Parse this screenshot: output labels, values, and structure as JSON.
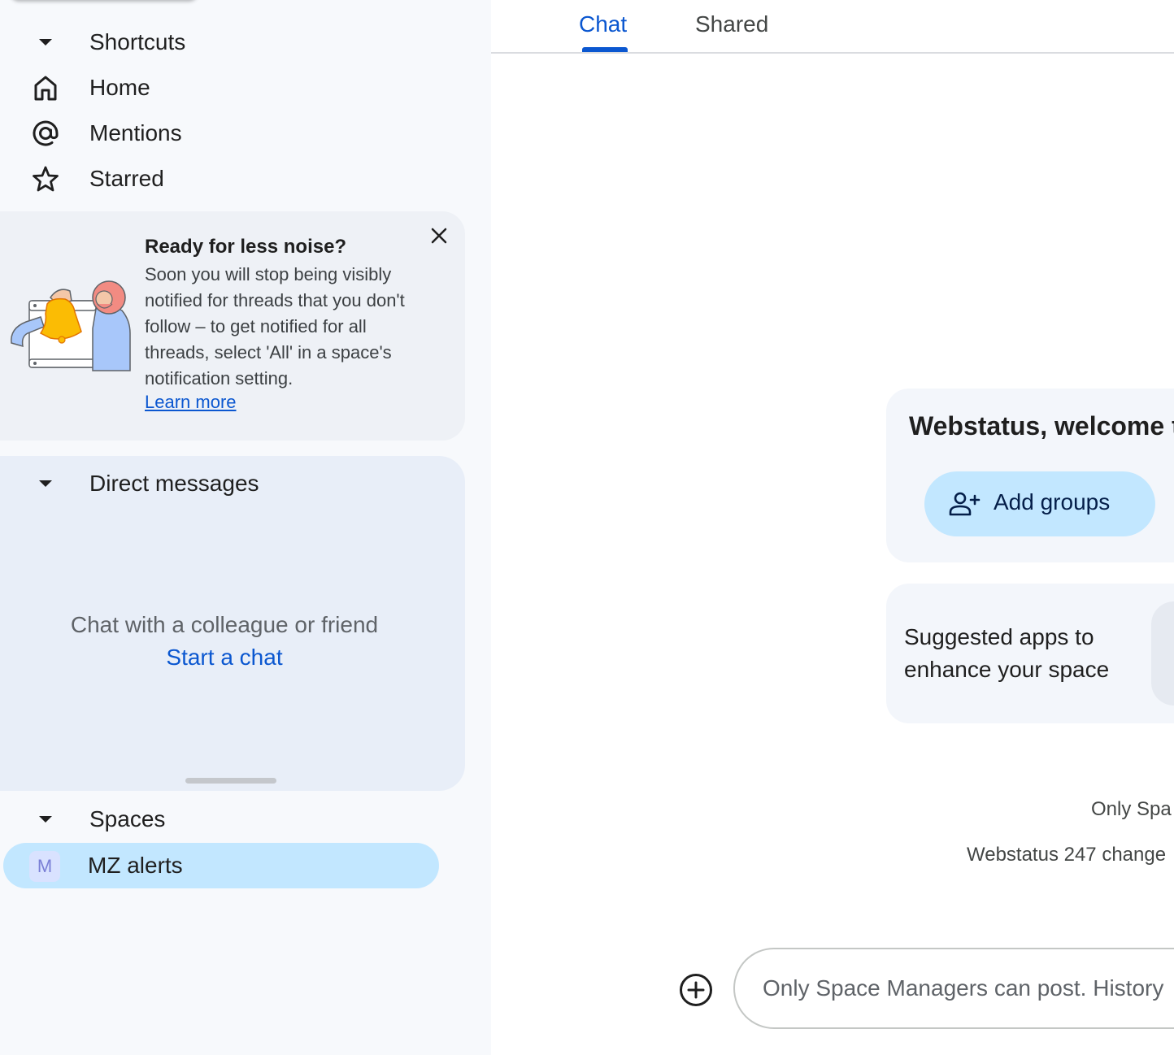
{
  "sidebar": {
    "shortcuts": {
      "header": "Shortcuts",
      "items": [
        {
          "label": "Home",
          "icon": "home-icon"
        },
        {
          "label": "Mentions",
          "icon": "at-icon"
        },
        {
          "label": "Starred",
          "icon": "star-icon"
        }
      ]
    },
    "promo": {
      "title": "Ready for less noise?",
      "body": "Soon you will stop being visibly notified for threads that you don't follow – to get notified for all threads, select 'All' in a space's notification setting.",
      "link": "Learn more",
      "close_icon": "close-icon",
      "illustration": "bell-notification-illustration"
    },
    "direct_messages": {
      "header": "Direct messages",
      "empty_text": "Chat with a colleague or friend",
      "start_link": "Start a chat"
    },
    "spaces": {
      "header": "Spaces",
      "items": [
        {
          "avatar": "M",
          "label": "MZ alerts",
          "selected": true
        }
      ]
    }
  },
  "main": {
    "tabs": [
      {
        "label": "Chat",
        "active": true
      },
      {
        "label": "Shared",
        "active": false
      }
    ],
    "welcome": {
      "title": "Webstatus, welcome t",
      "add_groups_label": "Add groups",
      "add_groups_icon": "person-add-icon"
    },
    "apps": {
      "text": "Suggested apps to enhance your space"
    },
    "info_line_1": "Only Spa",
    "info_line_2": "Webstatus 247 change",
    "composer": {
      "add_icon": "add-circle-icon",
      "placeholder": "Only Space Managers can post. History"
    }
  },
  "colors": {
    "accent": "#0b57d0",
    "selected_bg": "#c2e7ff",
    "sidebar_bg": "#f7f9fc",
    "dm_card_bg": "#e8eef8"
  }
}
